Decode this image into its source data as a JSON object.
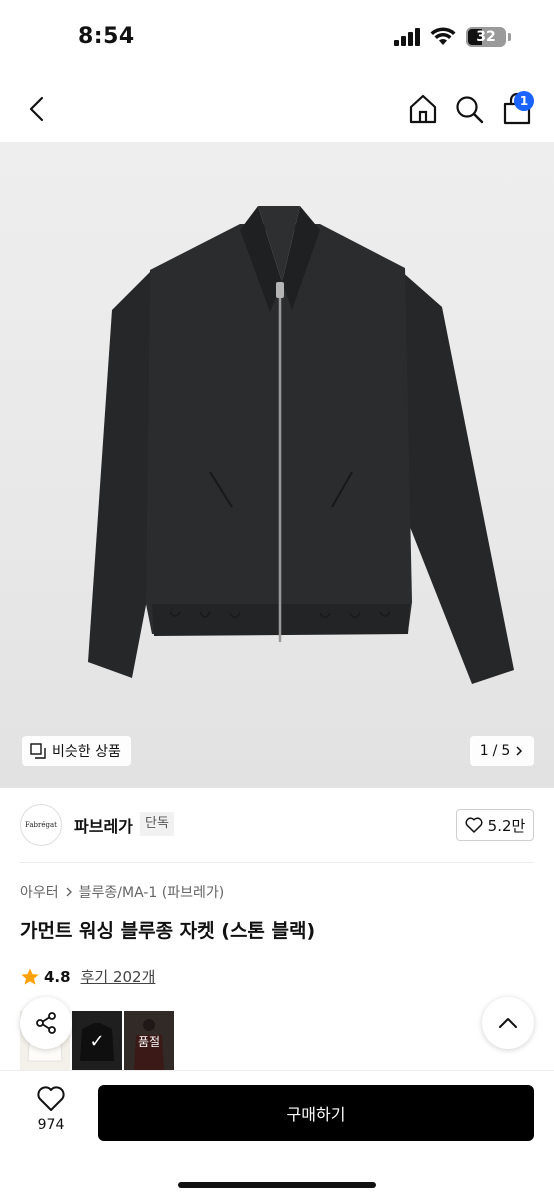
{
  "status_bar": {
    "time": "8:54",
    "battery_level": "32"
  },
  "header": {
    "back_icon": "chevron-left-icon",
    "home_icon": "home-icon",
    "search_icon": "search-icon",
    "cart_icon": "shopping-bag-icon",
    "cart_badge": "1",
    "badge_color": "#1a63ff"
  },
  "gallery": {
    "similar_label": "비슷한 상품",
    "page_current": "1",
    "page_total": "5",
    "page_separator": "/"
  },
  "brand": {
    "logo_text": "Fabrégat",
    "name": "파브레가",
    "badge": "단독",
    "like_count": "5.2만"
  },
  "product": {
    "breadcrumb": [
      "아우터",
      "블루종/MA-1 (파브레가)"
    ],
    "title": "가먼트 워싱 블루종 자켓 (스톤 블랙)",
    "rating": "4.8",
    "review_label": "후기 202개",
    "star_color": "#ffa200",
    "thumbs": [
      {
        "color": "white",
        "selected": false,
        "sold_out": false
      },
      {
        "color": "black",
        "selected": true,
        "sold_out": false
      },
      {
        "color": "brown",
        "selected": false,
        "sold_out": true,
        "sold_out_label": "품절"
      }
    ]
  },
  "bottom_bar": {
    "wish_count": "974",
    "buy_label": "구매하기"
  }
}
